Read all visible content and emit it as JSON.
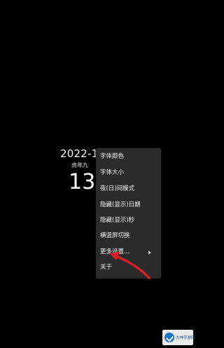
{
  "clock": {
    "date": "2022-10-",
    "weekday": "虎年九",
    "time": "13:"
  },
  "menu": {
    "items": [
      {
        "label": "字体颜色"
      },
      {
        "label": "字体大小"
      },
      {
        "label": "夜(日)间模式"
      },
      {
        "label": "隐藏(显示)日期"
      },
      {
        "label": "隐藏(显示)秒"
      },
      {
        "label": "横竖屏切换"
      },
      {
        "label": "更多设置..."
      },
      {
        "label": "关于"
      }
    ]
  },
  "annotation": {
    "arrow_color": "#d3202a"
  },
  "watermark": {
    "text": "大神手游网"
  }
}
